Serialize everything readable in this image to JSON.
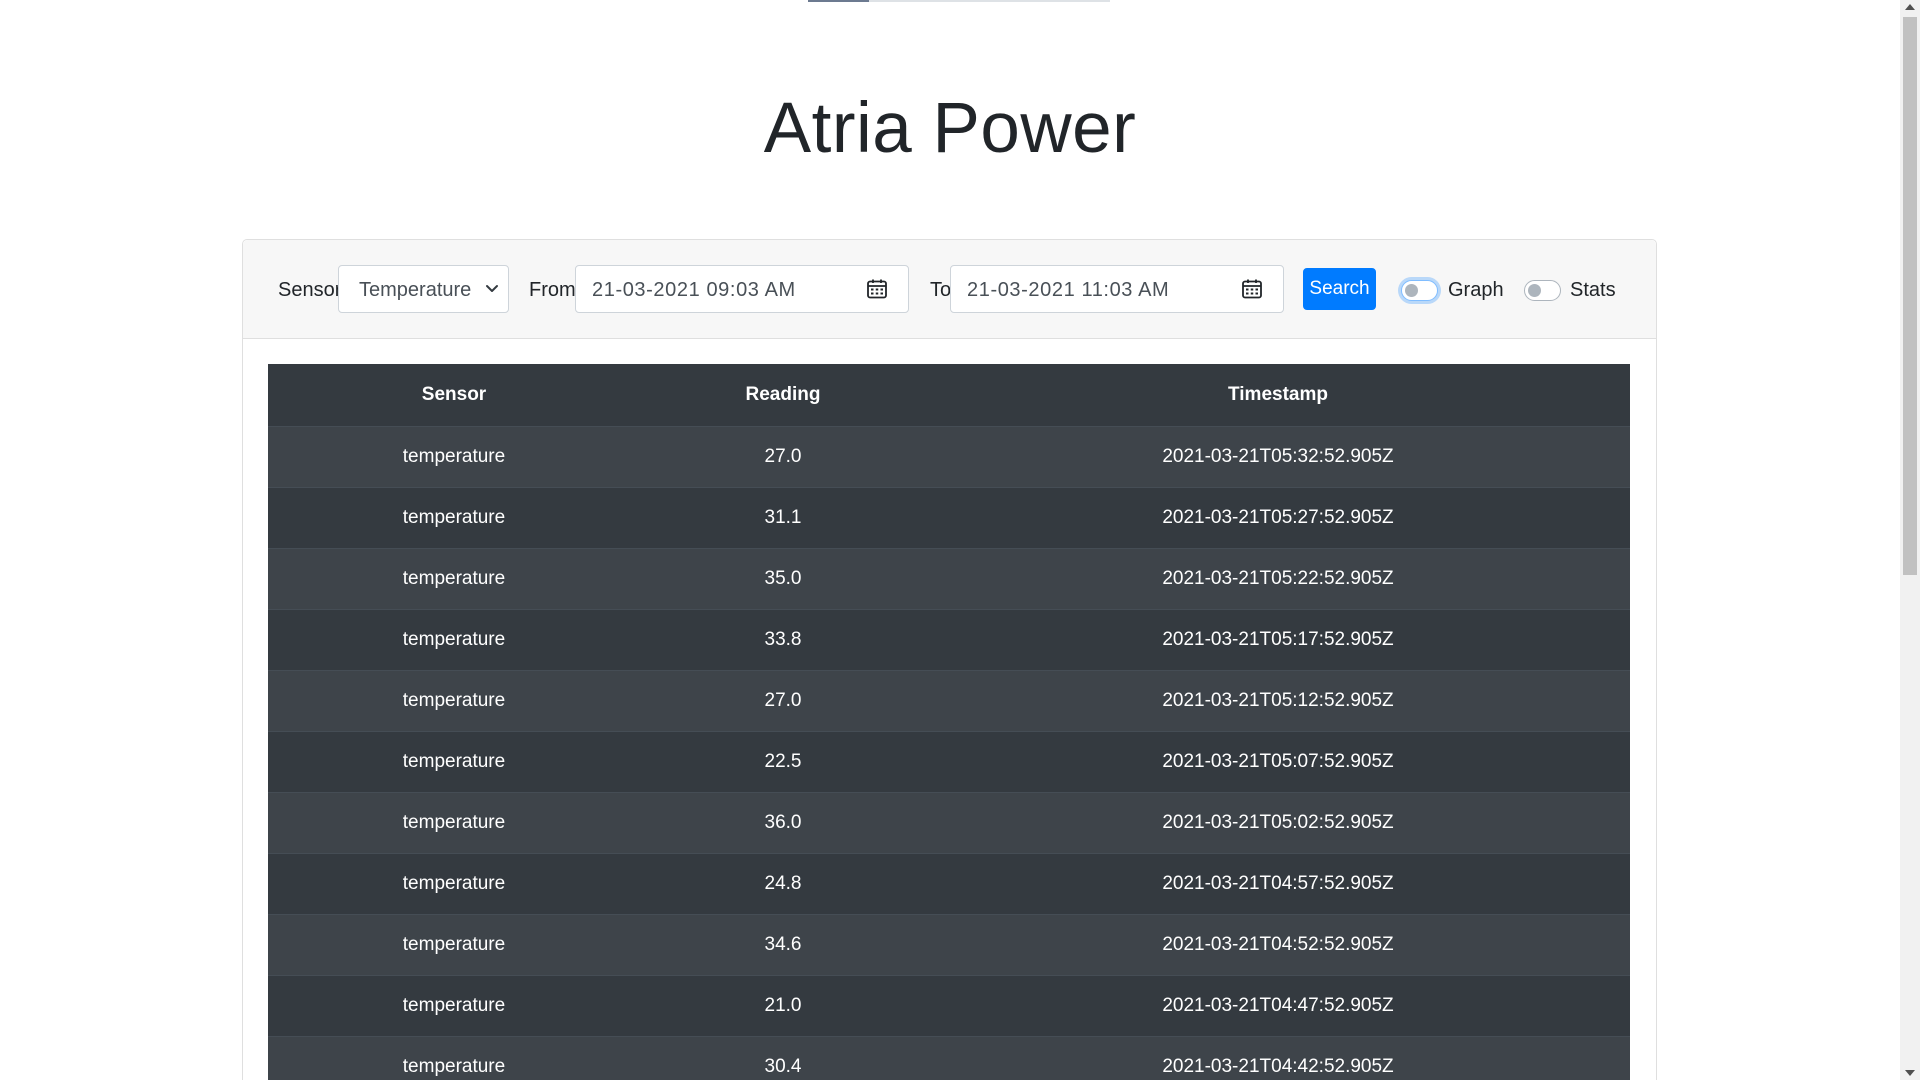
{
  "app": {
    "title": "Atria Power"
  },
  "filters": {
    "sensor_label": "Sensor",
    "sensor_value": "Temperature",
    "from_label": "From",
    "from_value": "21-03-2021 09:03  AM",
    "to_label": "To",
    "to_value": "21-03-2021 11:03  AM",
    "search_label": "Search",
    "graph_label": "Graph",
    "graph_on": false,
    "stats_label": "Stats",
    "stats_on": false
  },
  "table": {
    "headers": [
      "Sensor",
      "Reading",
      "Timestamp"
    ],
    "rows": [
      [
        "temperature",
        "27.0",
        "2021-03-21T05:32:52.905Z"
      ],
      [
        "temperature",
        "31.1",
        "2021-03-21T05:27:52.905Z"
      ],
      [
        "temperature",
        "35.0",
        "2021-03-21T05:22:52.905Z"
      ],
      [
        "temperature",
        "33.8",
        "2021-03-21T05:17:52.905Z"
      ],
      [
        "temperature",
        "27.0",
        "2021-03-21T05:12:52.905Z"
      ],
      [
        "temperature",
        "22.5",
        "2021-03-21T05:07:52.905Z"
      ],
      [
        "temperature",
        "36.0",
        "2021-03-21T05:02:52.905Z"
      ],
      [
        "temperature",
        "24.8",
        "2021-03-21T04:57:52.905Z"
      ],
      [
        "temperature",
        "34.6",
        "2021-03-21T04:52:52.905Z"
      ],
      [
        "temperature",
        "21.0",
        "2021-03-21T04:47:52.905Z"
      ],
      [
        "temperature",
        "30.4",
        "2021-03-21T04:42:52.905Z"
      ]
    ]
  },
  "colors": {
    "primary": "#007bff",
    "table_dark": "#343a40",
    "table_stripe": "#3e444a"
  },
  "icons": {
    "sensor_dropdown": "chevron-down-icon",
    "date_picker": "calendar-icon"
  }
}
